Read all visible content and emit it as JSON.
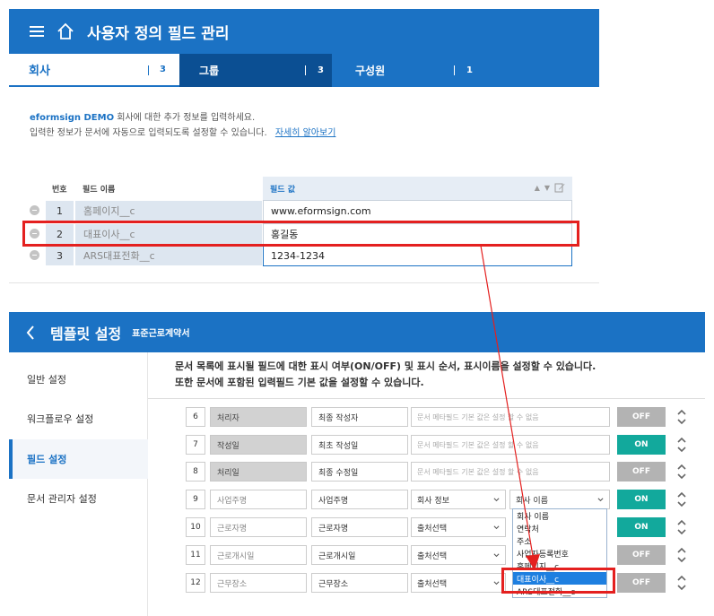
{
  "panel1": {
    "title": "사용자 정의 필드 관리",
    "tabs": [
      {
        "label": "회사",
        "count": "3"
      },
      {
        "label": "그룹",
        "count": "3"
      },
      {
        "label": "구성원",
        "count": "1"
      }
    ],
    "desc": {
      "brand": "eformsign DEMO",
      "line1_rest": "회사에 대한 추가 정보를 입력하세요.",
      "line2": "입력한 정보가 문서에 자동으로 입력되도록 설정할 수 있습니다.",
      "link": "자세히 알아보기"
    },
    "table": {
      "headers": {
        "num": "번호",
        "name": "필드 이름",
        "value": "필드 값"
      },
      "rows": [
        {
          "num": "1",
          "name": "홈페이지__c",
          "value": "www.eformsign.com"
        },
        {
          "num": "2",
          "name": "대표이사__c",
          "value": "홍길동"
        },
        {
          "num": "3",
          "name": "ARS대표전화__c",
          "value": "1234-1234"
        }
      ]
    }
  },
  "panel2": {
    "title": "템플릿 설정",
    "subtitle": "표준근로계약서",
    "sidebar": [
      "일반 설정",
      "워크플로우 설정",
      "필드 설정",
      "문서 관리자 설정"
    ],
    "desc": {
      "line1": "문서 목록에 표시될 필드에 대한 표시 여부(ON/OFF) 및 표시 순서, 표시이름을 설정할 수 있습니다.",
      "line2": "또한 문서에 포함된 입력필드 기본 값을 설정할 수 있습니다."
    },
    "rows": [
      {
        "num": "6",
        "field": "처리자",
        "display": "최종 작성자",
        "meta": "문서 메타필드 기본 값은 설정 할 수 없음",
        "toggle": "OFF"
      },
      {
        "num": "7",
        "field": "작성일",
        "display": "최초 작성일",
        "meta": "문서 메타필드 기본 값은 설정 할 수 없음",
        "toggle": "ON"
      },
      {
        "num": "8",
        "field": "처리일",
        "display": "최종 수정일",
        "meta": "문서 메타필드 기본 값은 설정 할 수 없음",
        "toggle": "OFF"
      },
      {
        "num": "9",
        "field": "사업주명",
        "display": "사업주명",
        "sel1": "회사 정보",
        "sel2": "회사 이름",
        "toggle": "ON"
      },
      {
        "num": "10",
        "field": "근로자명",
        "display": "근로자명",
        "sel1": "출처선택",
        "toggle": "ON"
      },
      {
        "num": "11",
        "field": "근로개시일",
        "display": "근로개시일",
        "sel1": "출처선택",
        "toggle": "OFF"
      },
      {
        "num": "12",
        "field": "근무장소",
        "display": "근무장소",
        "sel1": "출처선택",
        "toggle": "OFF"
      }
    ],
    "dropdown": [
      "회사 이름",
      "연락처",
      "주소",
      "사업자등록번호",
      "홈페이지__c",
      "대표이사__c",
      "ARS대표전화__c"
    ]
  },
  "colors": {
    "primary": "#1b72c4",
    "on": "#12a99c",
    "off": "#b3b3b3",
    "highlight": "#e4201f"
  }
}
